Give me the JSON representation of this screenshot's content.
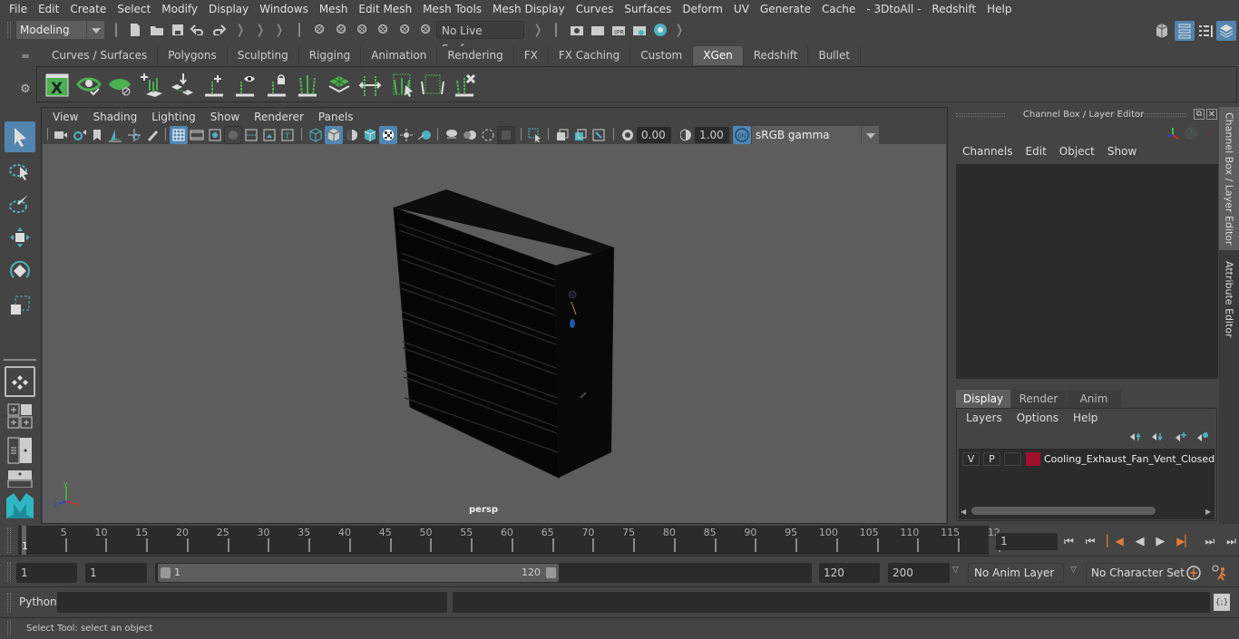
{
  "menubar": [
    "File",
    "Edit",
    "Create",
    "Select",
    "Modify",
    "Display",
    "Windows",
    "Mesh",
    "Edit Mesh",
    "Mesh Tools",
    "Mesh Display",
    "Curves",
    "Surfaces",
    "Deform",
    "UV",
    "Generate",
    "Cache",
    "- 3DtoAll -",
    "Redshift",
    "Help"
  ],
  "statusline": {
    "workspace": "Modeling",
    "live_surface": "No Live Surface"
  },
  "shelf": {
    "tabs": [
      "Curves / Surfaces",
      "Polygons",
      "Sculpting",
      "Rigging",
      "Animation",
      "Rendering",
      "FX",
      "FX Caching",
      "Custom",
      "XGen",
      "Redshift",
      "Bullet"
    ],
    "active_tab": "XGen",
    "icons": [
      "xgen-library-icon",
      "xgen-preview-icon",
      "xgen-clear-preview-icon",
      "add-guides-icon",
      "place-guides-icon",
      "add-guide-icon",
      "show-guides-icon",
      "lock-guides-icon",
      "guide-split-icon",
      "xgen-patch-icon",
      "scale-guides-icon",
      "select-guides-icon",
      "guide-region-icon",
      "delete-guides-icon"
    ]
  },
  "viewport": {
    "menu": [
      "View",
      "Shading",
      "Lighting",
      "Show",
      "Renderer",
      "Panels"
    ],
    "exposure": "0.00",
    "gamma": "1.00",
    "color_management": "ON",
    "color_space": "sRGB gamma",
    "camera_label": "persp",
    "axis": {
      "x": "x",
      "y": "y",
      "z": "z"
    }
  },
  "channel_box": {
    "title": "Channel Box / Layer Editor",
    "menu": [
      "Channels",
      "Edit",
      "Object",
      "Show"
    ]
  },
  "layer_editor": {
    "tabs": [
      "Display",
      "Render",
      "Anim"
    ],
    "active_tab": "Display",
    "menu": [
      "Layers",
      "Options",
      "Help"
    ],
    "layers": [
      {
        "v": "V",
        "p": "P",
        "color": "#a0102a",
        "name": "Cooling_Exhaust_Fan_Vent_Closed"
      }
    ]
  },
  "side_tabs": [
    "Channel Box / Layer Editor",
    "Attribute Editor"
  ],
  "timeline": {
    "ticks": [
      "5",
      "10",
      "15",
      "20",
      "25",
      "30",
      "35",
      "40",
      "45",
      "50",
      "55",
      "60",
      "65",
      "70",
      "75",
      "80",
      "85",
      "90",
      "95",
      "100",
      "105",
      "110",
      "115",
      "12"
    ],
    "current_frame_marker": "1",
    "current_frame": "1"
  },
  "range": {
    "start": "1",
    "playback_start": "1",
    "slider_start": "1",
    "slider_end": "120",
    "playback_end": "120",
    "end": "200",
    "anim_layer": "No Anim Layer",
    "character_set": "No Character Set"
  },
  "command_line": {
    "language": "Python",
    "input": "",
    "output": ""
  },
  "help_line": "Select Tool: select an object",
  "colors": {
    "accent": "#5285b0",
    "teal": "#4fb3bf",
    "xgen_green": "#4caf50",
    "playback_orange": "#e07b39"
  }
}
